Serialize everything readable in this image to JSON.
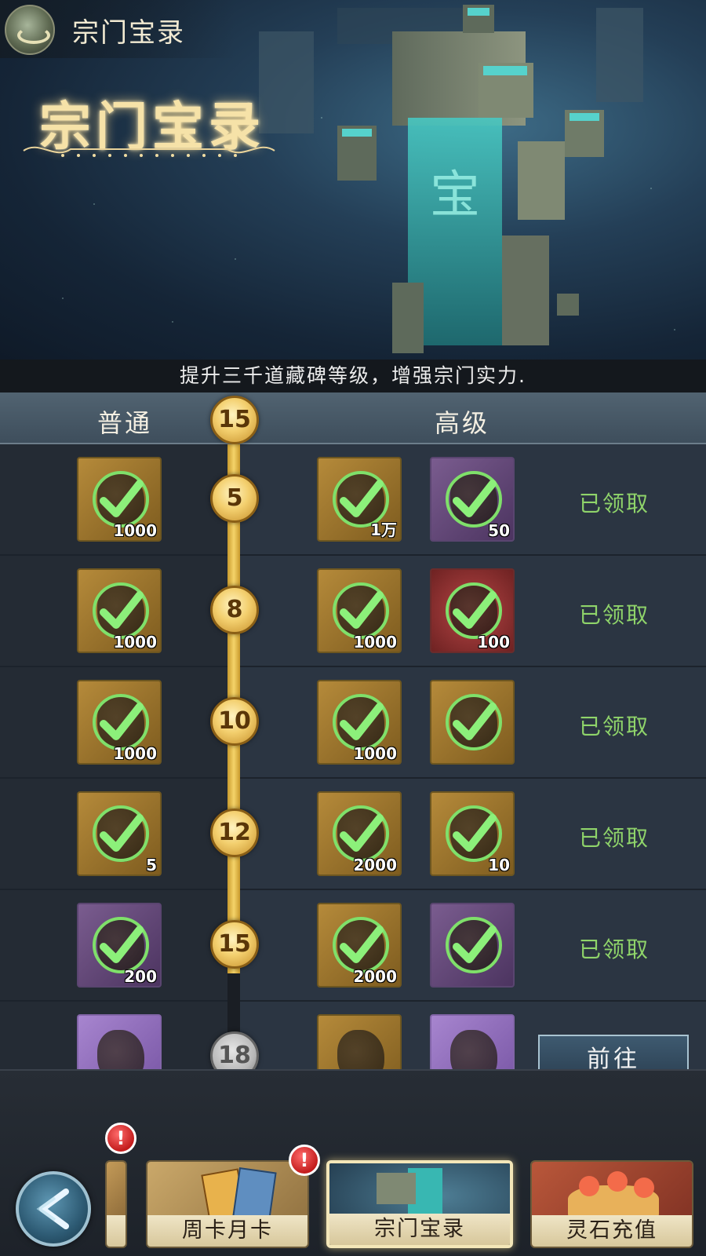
{
  "header": {
    "title": "宗门宝录",
    "logo_text": "宗门宝录"
  },
  "caption": "提升三千道藏碑等级，增强宗门实力.",
  "list": {
    "col_normal": "普通",
    "col_advanced": "高级",
    "current_level": "15",
    "rows": [
      {
        "level": "5",
        "normal": {
          "qty": "1000",
          "style": "gold"
        },
        "adv1": {
          "qty": "1万",
          "style": "gold"
        },
        "adv2": {
          "qty": "50",
          "style": "purple"
        },
        "status": "已领取"
      },
      {
        "level": "8",
        "normal": {
          "qty": "1000",
          "style": "gold"
        },
        "adv1": {
          "qty": "1000",
          "style": "gold"
        },
        "adv2": {
          "qty": "100",
          "style": "red"
        },
        "status": "已领取"
      },
      {
        "level": "10",
        "normal": {
          "qty": "1000",
          "style": "gold"
        },
        "adv1": {
          "qty": "1000",
          "style": "gold"
        },
        "adv2": {
          "qty": "",
          "style": "gold"
        },
        "status": "已领取"
      },
      {
        "level": "12",
        "normal": {
          "qty": "5",
          "style": "gold"
        },
        "adv1": {
          "qty": "2000",
          "style": "gold"
        },
        "adv2": {
          "qty": "10",
          "style": "gold"
        },
        "status": "已领取"
      },
      {
        "level": "15",
        "normal": {
          "qty": "200",
          "style": "purple"
        },
        "adv1": {
          "qty": "2000",
          "style": "gold"
        },
        "adv2": {
          "qty": "",
          "style": "purple"
        },
        "status": "已领取"
      },
      {
        "level": "18",
        "normal": {
          "qty": "",
          "style": "violet"
        },
        "adv1": {
          "qty": "",
          "style": "gold"
        },
        "adv2": {
          "qty": "",
          "style": "violet"
        },
        "status": "前往"
      }
    ]
  },
  "tabs": [
    {
      "label": "周卡月卡",
      "badge": "!"
    },
    {
      "label": "宗门宝录"
    },
    {
      "label": "灵石充值"
    }
  ],
  "extra_badge": "!",
  "colors": {
    "claimed": "#8fd46a",
    "track_gold": "#f5d46a",
    "accent_check": "#7fe06a"
  }
}
